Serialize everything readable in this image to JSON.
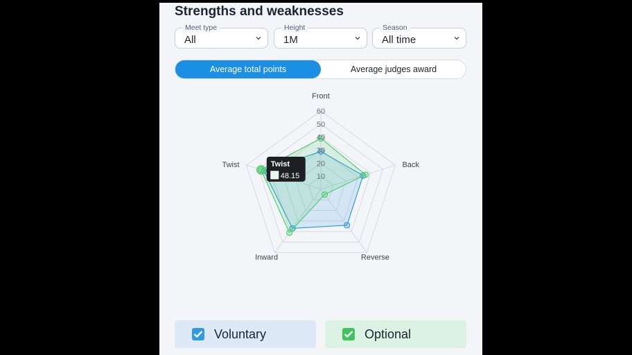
{
  "header": {
    "title": "Strengths and weaknesses"
  },
  "filters": [
    {
      "label": "Meet type",
      "value": "All"
    },
    {
      "label": "Height",
      "value": "1M"
    },
    {
      "label": "Season",
      "value": "All time"
    }
  ],
  "tabs": [
    {
      "label": "Average total points",
      "active": true
    },
    {
      "label": "Average judges award",
      "active": false
    }
  ],
  "chart_data": {
    "type": "radar",
    "axes": [
      "Front",
      "Back",
      "Reverse",
      "Inward",
      "Twist"
    ],
    "scale": {
      "min": 0,
      "max": 60,
      "ticks": [
        10,
        20,
        30,
        40,
        50,
        60
      ]
    },
    "series": [
      {
        "name": "Voluntary",
        "color": "#2f9be0",
        "values": [
          29,
          34,
          34,
          37,
          46
        ]
      },
      {
        "name": "Optional",
        "color": "#4fcf6a",
        "values": [
          39,
          36,
          5,
          41,
          48.15
        ]
      }
    ],
    "tooltip": {
      "axis": "Twist",
      "value": "48.15",
      "series": "Optional"
    }
  },
  "legend": [
    {
      "label": "Voluntary",
      "color": "#2f9be0",
      "bg": "#dde9f7",
      "checked": true
    },
    {
      "label": "Optional",
      "color": "#3ec45a",
      "bg": "#dcf2e2",
      "checked": true
    }
  ]
}
